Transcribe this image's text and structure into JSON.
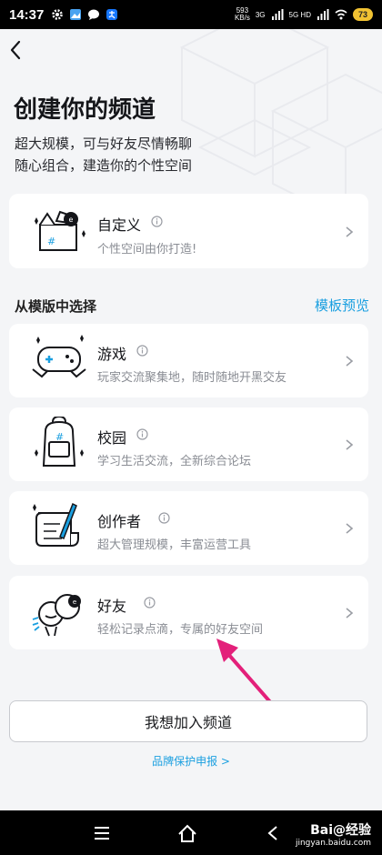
{
  "status_bar": {
    "time": "14:37",
    "net_speed_value": "593",
    "net_speed_unit": "KB/s",
    "net_3g": "3G",
    "net_5g": "5G HD",
    "battery": "73"
  },
  "header": {
    "title": "创建你的频道",
    "subtitle_line1": "超大规模，可与好友尽情畅聊",
    "subtitle_line2": "随心组合，建造你的个性空间"
  },
  "custom_card": {
    "title": "自定义",
    "desc": "个性空间由你打造!"
  },
  "templates": {
    "section_label": "从模版中选择",
    "preview_link": "模板预览",
    "items": [
      {
        "title": "游戏",
        "desc": "玩家交流聚集地，随时随地开黑交友"
      },
      {
        "title": "校园",
        "desc": "学习生活交流，全新综合论坛"
      },
      {
        "title": "创作者",
        "desc": "超大管理规模，丰富运营工具"
      },
      {
        "title": "好友",
        "desc": "轻松记录点滴，专属的好友空间"
      }
    ]
  },
  "join_button": "我想加入频道",
  "brand_link": "品牌保护申报 >",
  "watermark": {
    "main": "Bai@经验",
    "sub": "jingyan.baidu.com"
  },
  "colors": {
    "accent": "#1a9fe0",
    "annotation_arrow": "#e3207a"
  }
}
